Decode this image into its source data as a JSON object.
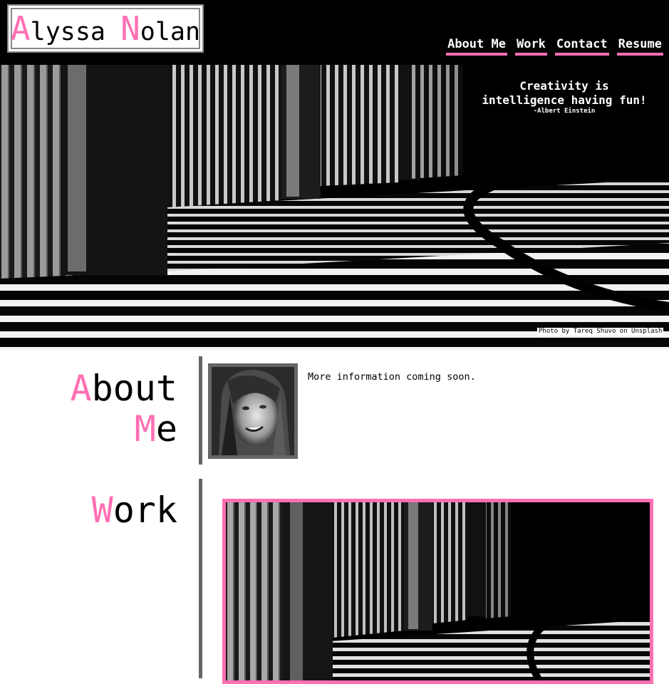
{
  "site": {
    "logo": {
      "first_initial": "A",
      "first_rest": "lyssa ",
      "last_initial": "N",
      "last_rest": "olan"
    },
    "nav": [
      {
        "label": "About Me"
      },
      {
        "label": "Work"
      },
      {
        "label": "Contact"
      },
      {
        "label": "Resume"
      }
    ]
  },
  "hero": {
    "quote": "Creativity is intelligence having fun!",
    "quote_author": "-Albert Einstein",
    "photo_credit": "Photo by Tareq Shuvo on Unsplash"
  },
  "about": {
    "title_line1_initial": "A",
    "title_line1_rest": "bout",
    "title_line2_initial": "M",
    "title_line2_rest": "e",
    "text": "More information coming soon."
  },
  "work": {
    "title_initial": "W",
    "title_rest": "ork"
  },
  "colors": {
    "accent": "#ff6fb3",
    "header_bg": "#000000",
    "divider": "#666666"
  }
}
